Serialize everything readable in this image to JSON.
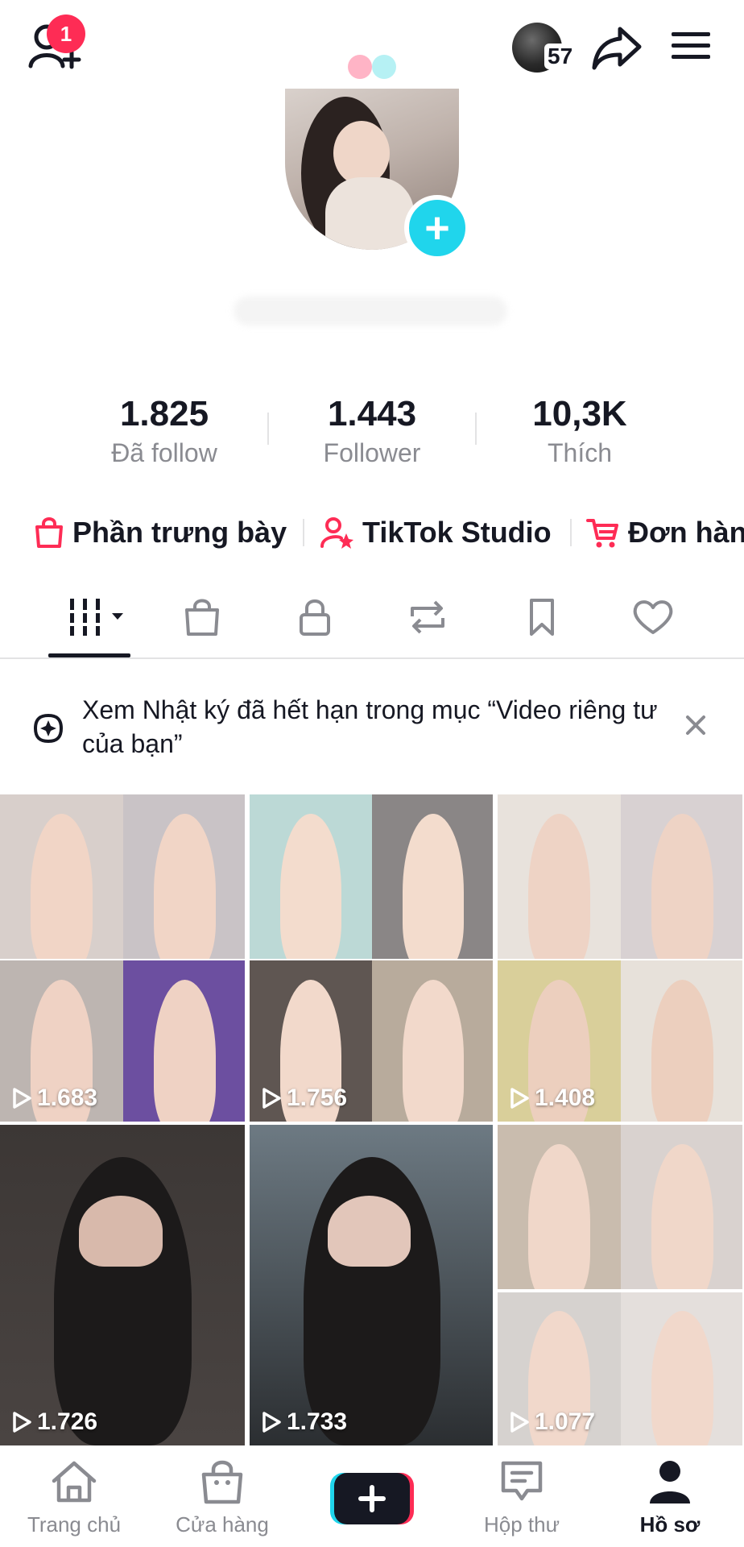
{
  "header": {
    "notification_badge": "1",
    "story_count": "57",
    "icons": [
      "add-friend-icon",
      "share-icon",
      "menu-icon"
    ]
  },
  "stats": [
    {
      "value": "1.825",
      "label": "Đã follow"
    },
    {
      "value": "1.443",
      "label": "Follower"
    },
    {
      "value": "10,3K",
      "label": "Thích"
    }
  ],
  "quick_links": [
    {
      "label": "Phần trưng bày",
      "icon": "shopping-bag-icon"
    },
    {
      "label": "TikTok Studio",
      "icon": "creator-icon"
    },
    {
      "label": "Đơn hàn",
      "icon": "cart-icon"
    }
  ],
  "tabs": [
    "videos-tab",
    "shop-tab",
    "private-tab",
    "reposts-tab",
    "favorites-tab",
    "liked-tab"
  ],
  "banner": {
    "text": "Xem Nhật ký đã hết hạn trong mục “Video riêng tư của bạn”"
  },
  "videos": [
    {
      "views": ""
    },
    {
      "views": ""
    },
    {
      "views": ""
    },
    {
      "views": "1.683"
    },
    {
      "views": "1.756"
    },
    {
      "views": "1.408"
    },
    {
      "views": "1.726"
    },
    {
      "views": "1.733"
    },
    {
      "views": ""
    },
    {
      "views": "1.077"
    }
  ],
  "bottom_nav": [
    {
      "label": "Trang chủ",
      "icon": "home-icon"
    },
    {
      "label": "Cửa hàng",
      "icon": "shop-icon"
    },
    {
      "label": "",
      "icon": "create-icon"
    },
    {
      "label": "Hộp thư",
      "icon": "inbox-icon"
    },
    {
      "label": "Hồ sơ",
      "icon": "profile-icon"
    }
  ],
  "colors": {
    "accent": "#fe2c55",
    "cyan": "#20d5ec",
    "text": "#161823",
    "muted": "#8a8b91"
  }
}
